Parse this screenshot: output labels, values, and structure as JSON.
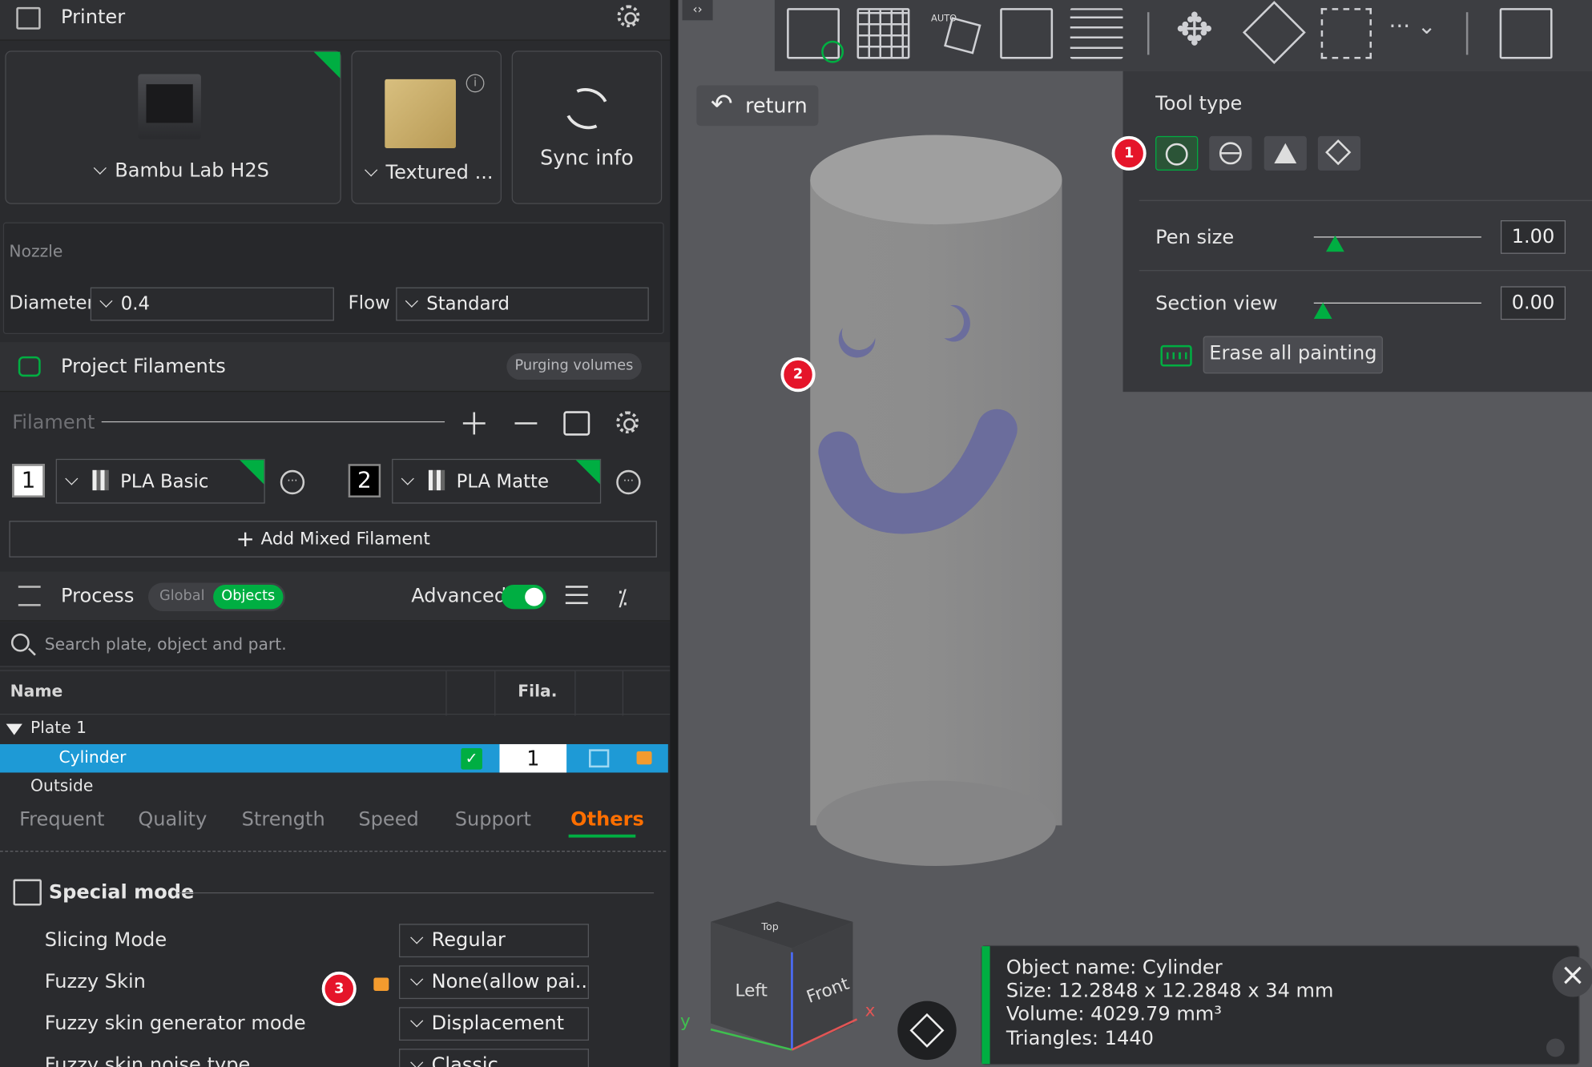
{
  "printer": {
    "title": "Printer",
    "model": "Bambu Lab H2S",
    "plate": "Textured ...",
    "sync_label": "Sync info"
  },
  "nozzle": {
    "section": "Nozzle",
    "diameter_label": "Diameter",
    "diameter_value": "0.4",
    "flow_label": "Flow",
    "flow_value": "Standard"
  },
  "filaments": {
    "title": "Project Filaments",
    "purging_label": "Purging volumes",
    "filament_label": "Filament",
    "items": [
      {
        "index": "1",
        "name": "PLA Basic"
      },
      {
        "index": "2",
        "name": "PLA Matte"
      }
    ],
    "add_mixed_label": "Add Mixed Filament"
  },
  "process": {
    "title": "Process",
    "toggle_global": "Global",
    "toggle_objects": "Objects",
    "advanced_label": "Advanced",
    "advanced_on": true,
    "search_placeholder": "Search plate, object and part."
  },
  "tree": {
    "col_name": "Name",
    "col_fila": "Fila.",
    "plate": "Plate 1",
    "object": "Cylinder",
    "object_filament": "1",
    "outside": "Outside"
  },
  "tabs": [
    "Frequent",
    "Quality",
    "Strength",
    "Speed",
    "Support",
    "Others"
  ],
  "active_tab": "Others",
  "special_mode": {
    "title": "Special mode",
    "options": [
      {
        "label": "Slicing Mode",
        "value": "Regular"
      },
      {
        "label": "Fuzzy Skin",
        "value": "None(allow pai..."
      },
      {
        "label": "Fuzzy skin generator mode",
        "value": "Displacement"
      },
      {
        "label": "Fuzzy skin noise type",
        "value": "Classic"
      }
    ]
  },
  "viewport": {
    "return_label": "return",
    "toolbar_auto": "AUTO",
    "cube_top": "Top",
    "cube_left": "Left",
    "cube_front": "Front",
    "axis_x": "x",
    "axis_y": "y"
  },
  "tool_panel": {
    "tool_type_label": "Tool type",
    "pen_size_label": "Pen size",
    "pen_size_value": "1.00",
    "section_view_label": "Section view",
    "section_view_value": "0.00",
    "erase_label": "Erase all painting"
  },
  "badges": [
    "1",
    "2",
    "3"
  ],
  "object_info": {
    "name": "Object name: Cylinder",
    "size": "Size: 12.2848 x 12.2848 x 34 mm",
    "volume": "Volume: 4029.79 mm³",
    "triangles": "Triangles: 1440"
  },
  "colors": {
    "accent_green": "#00ae42",
    "selection_blue": "#1e9ad6",
    "tab_active": "#ff6f00",
    "paint": "#6b6d9c",
    "badge_red": "#e5152a"
  }
}
